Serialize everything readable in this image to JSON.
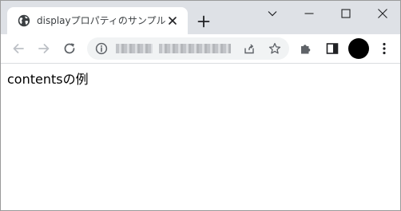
{
  "tab": {
    "title": "displayプロパティのサンプル",
    "favicon_icon": "globe-icon",
    "close_icon": "close-icon"
  },
  "new_tab_icon": "plus-icon",
  "window_controls": [
    "chevron-down-icon",
    "minimize-icon",
    "maximize-icon",
    "close-icon"
  ],
  "toolbar": {
    "back_icon": "arrow-left-icon",
    "forward_icon": "arrow-right-icon",
    "reload_icon": "reload-icon",
    "extensions_icon": "puzzle-icon",
    "side_panel_icon": "side-panel-icon",
    "menu_icon": "kebab-menu-icon"
  },
  "omnibox": {
    "site_info_icon": "info-icon",
    "url": "",
    "share_icon": "share-icon",
    "bookmark_icon": "star-icon"
  },
  "page": {
    "text": "contentsの例"
  },
  "colors": {
    "tabstrip_bg": "#dee1e6",
    "omnibox_bg": "#f1f3f4",
    "icon_color": "#5f6368",
    "avatar": "#000000"
  }
}
